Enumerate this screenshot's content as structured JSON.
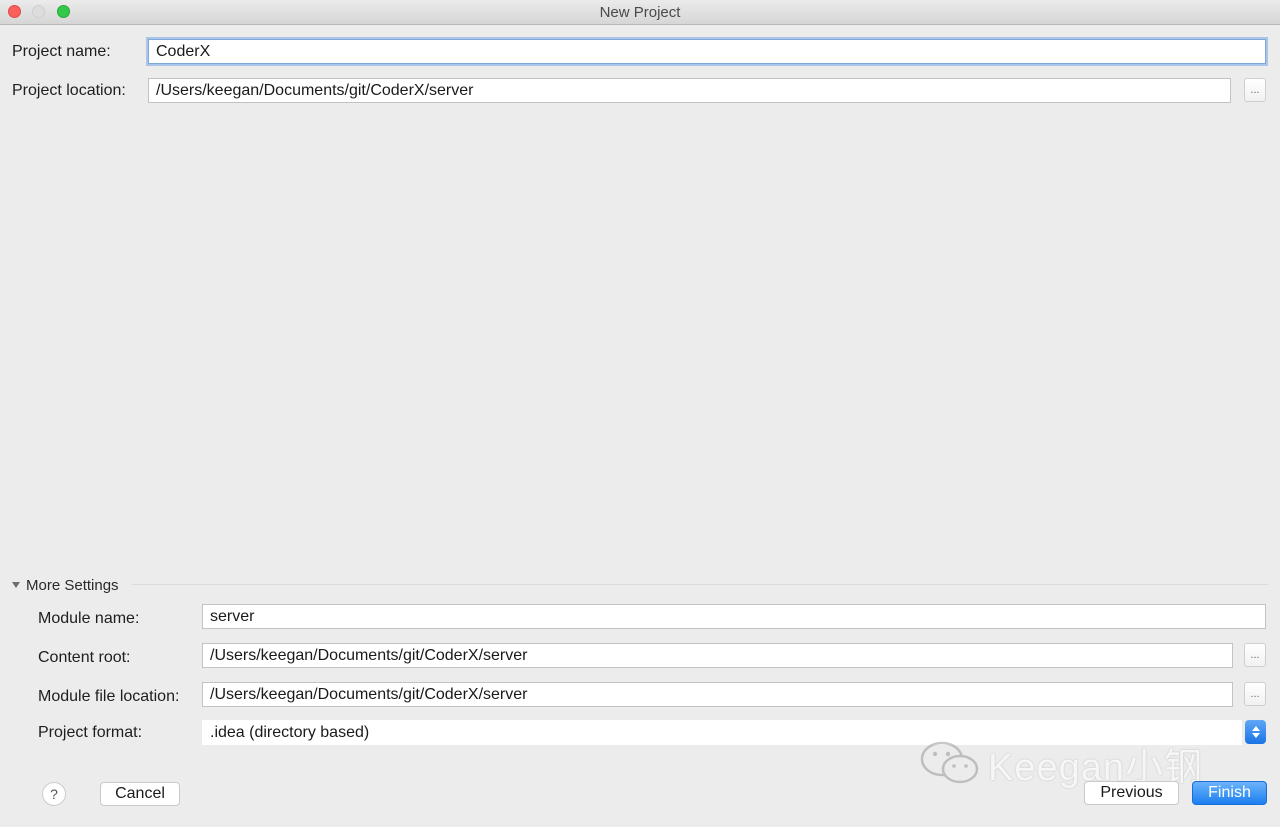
{
  "window": {
    "title": "New Project"
  },
  "project": {
    "name_label": "Project name:",
    "name_value": "CoderX",
    "location_label": "Project location:",
    "location_value": "/Users/keegan/Documents/git/CoderX/server",
    "browse_label": "..."
  },
  "more_settings": {
    "label": "More Settings",
    "module_name_label": "Module name:",
    "module_name_value": "server",
    "content_root_label": "Content root:",
    "content_root_value": "/Users/keegan/Documents/git/CoderX/server",
    "module_file_location_label": "Module file location:",
    "module_file_location_value": "/Users/keegan/Documents/git/CoderX/server",
    "project_format_label": "Project format:",
    "project_format_value": ".idea (directory based)",
    "browse_label": "..."
  },
  "footer": {
    "help_label": "?",
    "cancel_label": "Cancel",
    "previous_label": "Previous",
    "finish_label": "Finish"
  },
  "watermark": {
    "text": "Keegan小钢"
  },
  "colors": {
    "window_bg": "#ececec",
    "accent": "#1c7ff0",
    "close": "#fc605c",
    "maximize": "#34c84a"
  }
}
